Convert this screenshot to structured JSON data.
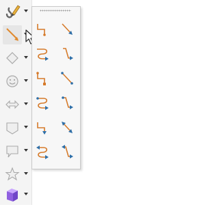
{
  "toolbar": {
    "tools": [
      {
        "icon": "pencil-icon"
      },
      {
        "icon": "line-icon",
        "selected": true
      },
      {
        "icon": "diamond-icon"
      },
      {
        "icon": "smiley-icon"
      },
      {
        "icon": "double-arrow-icon"
      },
      {
        "icon": "callout-icon"
      },
      {
        "icon": "speech-bubble-icon"
      },
      {
        "icon": "star-icon"
      },
      {
        "icon": "cube-icon"
      }
    ]
  },
  "palette": {
    "items": [
      {
        "icon": "connector-elbow-icon"
      },
      {
        "icon": "line-arrow-icon"
      },
      {
        "icon": "connector-curved-icon"
      },
      {
        "icon": "connector-elbow-arrow-icon"
      },
      {
        "icon": "connector-elbow-end-icon"
      },
      {
        "icon": "line-ends-icon"
      },
      {
        "icon": "connector-curved-arrow-icon"
      },
      {
        "icon": "connector-elbow-arrows-icon"
      },
      {
        "icon": "connector-elbow-start-icon"
      },
      {
        "icon": "line-arrow-both-icon"
      },
      {
        "icon": "connector-curved-both-icon"
      },
      {
        "icon": "connector-elbow-both-icon"
      }
    ]
  },
  "colors": {
    "connector": "#d57a2a",
    "line": "#2e6fa8",
    "accent": "#8f5fe0"
  }
}
